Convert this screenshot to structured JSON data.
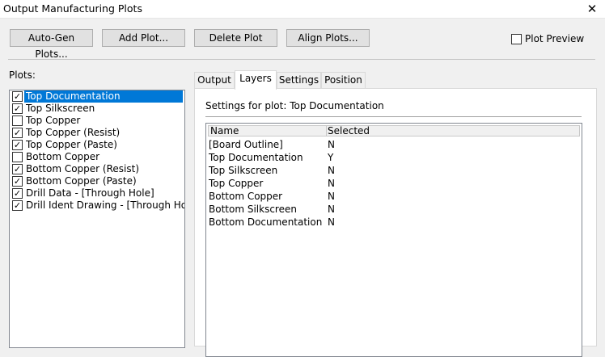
{
  "window": {
    "title": "Output Manufacturing Plots",
    "close_icon": "✕"
  },
  "toolbar": {
    "auto_gen": "Auto-Gen Plots...",
    "add": "Add Plot...",
    "delete": "Delete Plot",
    "align": "Align Plots...",
    "preview_label": "Plot Preview",
    "preview_checked": false
  },
  "plots": {
    "label": "Plots:",
    "items": [
      {
        "label": "Top Documentation",
        "checked": true,
        "selected": true
      },
      {
        "label": "Top Silkscreen",
        "checked": true
      },
      {
        "label": "Top Copper",
        "checked": false
      },
      {
        "label": "Top Copper (Resist)",
        "checked": true
      },
      {
        "label": "Top Copper (Paste)",
        "checked": true
      },
      {
        "label": "Bottom Copper",
        "checked": false
      },
      {
        "label": "Bottom Copper (Resist)",
        "checked": true
      },
      {
        "label": "Bottom Copper (Paste)",
        "checked": true
      },
      {
        "label": "Drill Data - [Through Hole]",
        "checked": true
      },
      {
        "label": "Drill Ident Drawing - [Through Hole",
        "checked": true
      }
    ]
  },
  "tabs": [
    "Output",
    "Layers",
    "Settings",
    "Position"
  ],
  "active_tab": "Layers",
  "layers_panel": {
    "settings_title": "Settings for plot: Top Documentation",
    "columns": {
      "name": "Name",
      "selected": "Selected"
    },
    "rows": [
      {
        "name": "[Board Outline]",
        "selected": "N"
      },
      {
        "name": "Top Documentation",
        "selected": "Y"
      },
      {
        "name": "Top Silkscreen",
        "selected": "N"
      },
      {
        "name": "Top Copper",
        "selected": "N"
      },
      {
        "name": "Bottom Copper",
        "selected": "N"
      },
      {
        "name": "Bottom Silkscreen",
        "selected": "N"
      },
      {
        "name": "Bottom Documentation",
        "selected": "N"
      }
    ]
  },
  "colors": {
    "selection": "#0078d7",
    "window_bg": "#f0f0f0"
  }
}
